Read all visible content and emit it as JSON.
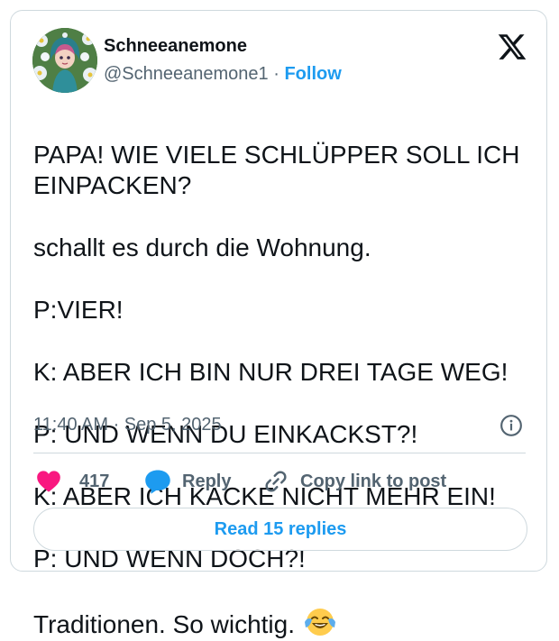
{
  "author": {
    "name": "Schneeanemone",
    "handle": "@Schneeanemone1",
    "separator": "·",
    "follow_label": "Follow",
    "avatar_icon": "avatar-illustration"
  },
  "tweet": {
    "lines": [
      "PAPA! WIE VIELE SCHLÜPPER SOLL ICH EINPACKEN?",
      "schallt es durch die Wohnung.",
      "P:VIER!",
      "K: ABER ICH BIN NUR DREI TAGE WEG!",
      "P: UND WENN DU EINKACKST?!",
      "K: ABER ICH KACKE NICHT MEHR EIN!",
      "P: UND WENN DOCH?!",
      "Traditionen. So wichtig. "
    ],
    "emoji": "face-with-tears-of-joy",
    "timestamp": "11:40 AM · Sep 5, 2025"
  },
  "actions": {
    "like_count": "417",
    "reply_label": "Reply",
    "copy_label": "Copy link to post"
  },
  "footer": {
    "read_replies_label": "Read 15 replies"
  },
  "colors": {
    "link": "#1d9bf0",
    "like": "#f91880",
    "muted": "#536471",
    "text": "#0f1419",
    "border": "#cfd9de"
  }
}
